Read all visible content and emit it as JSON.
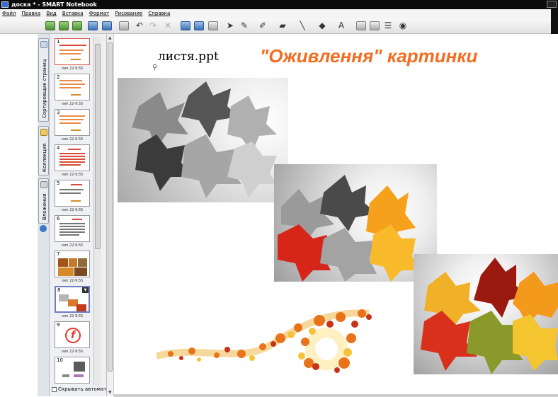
{
  "window": {
    "title": "доска * - SMART Notebook"
  },
  "menu": [
    {
      "label": "Файл"
    },
    {
      "label": "Правка"
    },
    {
      "label": "Вид"
    },
    {
      "label": "Вставка"
    },
    {
      "label": "Формат"
    },
    {
      "label": "Рисование"
    },
    {
      "label": "Справка"
    }
  ],
  "toolbar": {
    "icons": [
      "prev-page-icon",
      "next-page-icon",
      "add-page-icon",
      "open-icon",
      "save-icon",
      "paste-icon",
      "undo-icon",
      "redo-icon",
      "delete-icon",
      "screen-shade-icon",
      "full-screen-icon",
      "capture-icon",
      "select-icon",
      "pen-icon",
      "creative-pen-icon",
      "eraser-icon",
      "line-icon",
      "fill-icon",
      "text-icon",
      "properties-icon",
      "move-toolbar-icon",
      "more-icon"
    ]
  },
  "sidebar": {
    "tabs": [
      {
        "label": "Сортировщик страниц",
        "icon": "page-sorter-icon"
      },
      {
        "label": "Коллекция",
        "icon": "gallery-icon"
      },
      {
        "label": "Вложения",
        "icon": "attachments-icon"
      }
    ],
    "thumbnails": [
      {
        "number": "1",
        "date": "лип 22-9:55"
      },
      {
        "number": "2",
        "date": "лип 22-9:55"
      },
      {
        "number": "3",
        "date": "лип 22-9:55"
      },
      {
        "number": "4",
        "date": "лип 22-9:55"
      },
      {
        "number": "5",
        "date": "лип 22-9:55"
      },
      {
        "number": "6",
        "date": "лип 22-9:55"
      },
      {
        "number": "7",
        "date": "лип 22-9:55"
      },
      {
        "number": "8",
        "date": "лип 22-9:55",
        "selected": true
      },
      {
        "number": "9",
        "date": "лип 22-9:55"
      },
      {
        "number": "10",
        "date": ""
      }
    ],
    "auto_hide_label": "Скрывать автомат"
  },
  "canvas": {
    "file_label": "листя.ppt",
    "page_title": "\"Оживлення\" картинки",
    "title_color": "#f26d1f"
  }
}
